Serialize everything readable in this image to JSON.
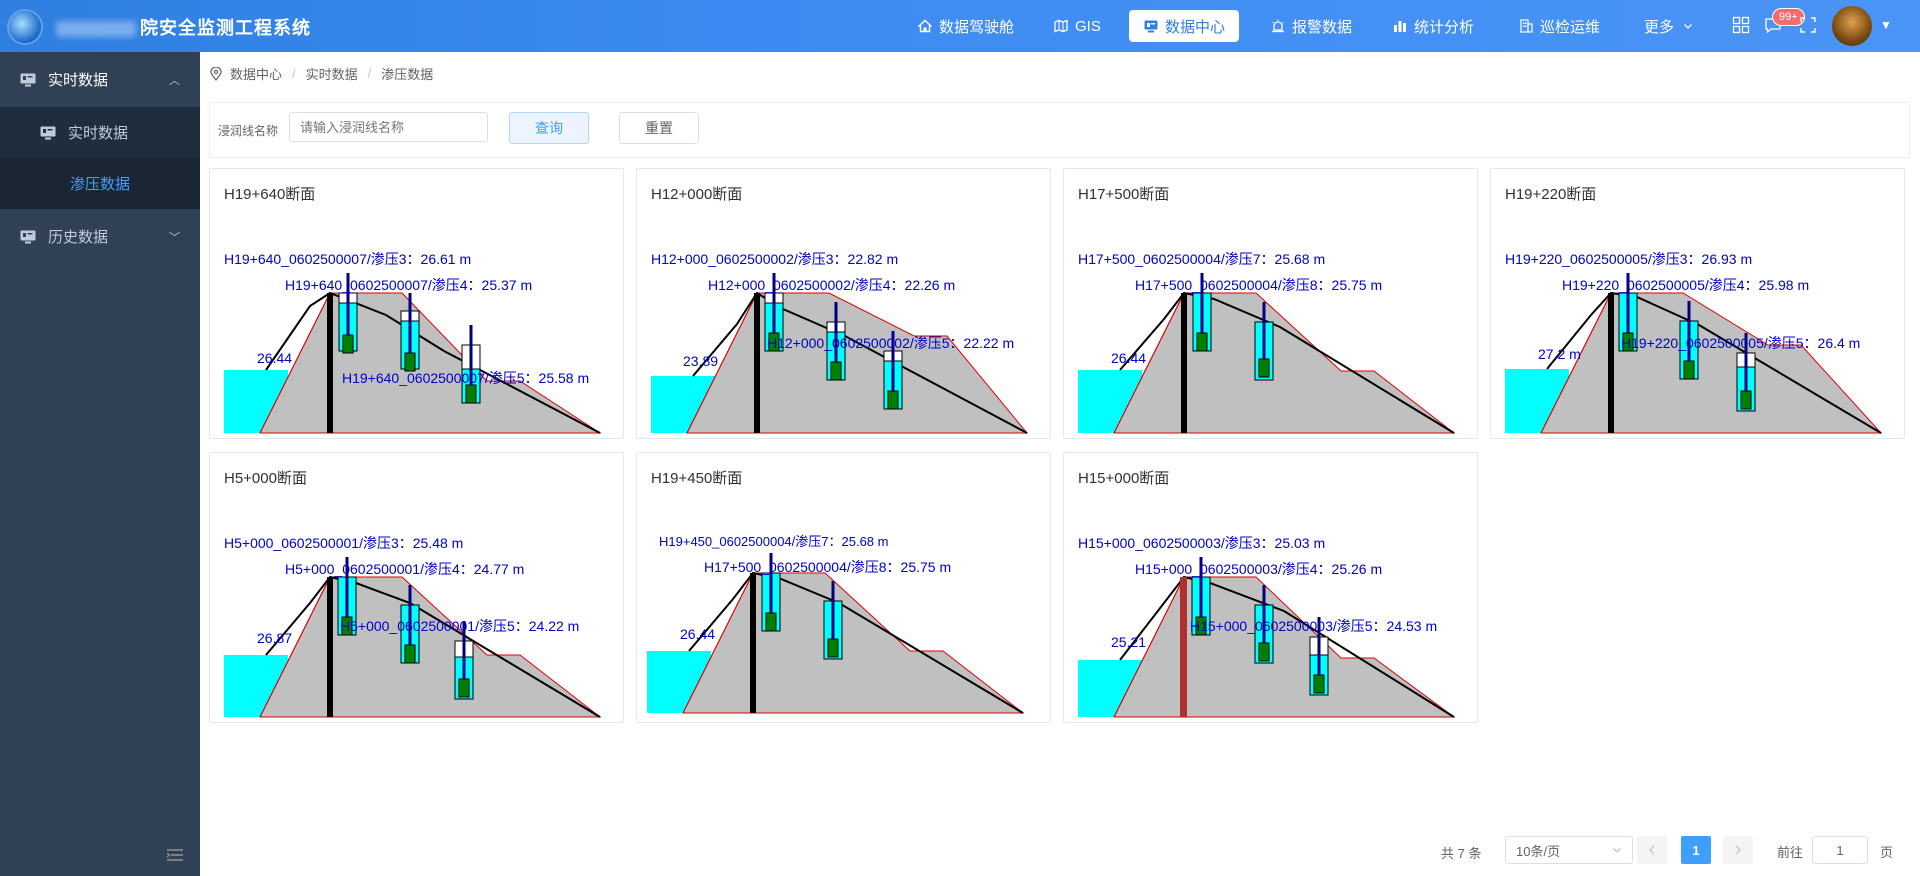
{
  "app": {
    "title": "院安全监测工程系统"
  },
  "nav": [
    {
      "label": "数据驾驶舱",
      "icon": "home-icon"
    },
    {
      "label": "GIS",
      "icon": "map-icon"
    },
    {
      "label": "数据中心",
      "icon": "monitor-icon",
      "active": true
    },
    {
      "label": "报警数据",
      "icon": "alarm-icon"
    },
    {
      "label": "统计分析",
      "icon": "bar-chart-icon"
    },
    {
      "label": "巡检运维",
      "icon": "building-icon"
    },
    {
      "label": "更多",
      "icon": "chevron-down-icon"
    }
  ],
  "notifications": {
    "badge": "99+"
  },
  "sidebar": {
    "items": [
      {
        "label": "实时数据",
        "expanded": true
      },
      {
        "label": "实时数据",
        "sub": true
      },
      {
        "label": "渗压数据",
        "sub": true,
        "active": true
      },
      {
        "label": "历史数据",
        "expanded": false
      }
    ]
  },
  "breadcrumb": [
    "数据中心",
    "实时数据",
    "渗压数据"
  ],
  "filter": {
    "label": "浸润线名称",
    "placeholder": "请输入浸润线名称",
    "query_label": "查询",
    "reset_label": "重置"
  },
  "colors": {
    "accent": "#409eff",
    "water": "#00ffff",
    "dam": "#c0c0c0",
    "label": "#0000cc",
    "sensor": "#008000"
  },
  "cards": [
    {
      "title": "H19+640断面",
      "water_level": "26.44",
      "labels": [
        "H19+640_0602500007/渗压3：26.61 m",
        "H19+640_0602500007/渗压4：25.37 m",
        "H19+640_0602500007/渗压5：25.58 m"
      ]
    },
    {
      "title": "H12+000断面",
      "water_level": "23.89",
      "labels": [
        "H12+000_0602500002/渗压3：22.82 m",
        "H12+000_0602500002/渗压4：22.26 m",
        "H12+000_0602500002/渗压5：22.22 m"
      ]
    },
    {
      "title": "H17+500断面",
      "water_level": "26.44",
      "labels": [
        "H17+500_0602500004/渗压7：25.68 m",
        "H17+500_0602500004/渗压8：25.75 m"
      ]
    },
    {
      "title": "H19+220断面",
      "water_level": "27.2 m",
      "labels": [
        "H19+220_0602500005/渗压3：26.93 m",
        "H19+220_0602500005/渗压4：25.98 m",
        "H19+220_0602500005/渗压5：26.4 m"
      ]
    },
    {
      "title": "H5+000断面",
      "water_level": "26.87",
      "labels": [
        "H5+000_0602500001/渗压3：25.48 m",
        "H5+000_0602500001/渗压4：24.77 m",
        "H5+000_0602500001/渗压5：24.22 m"
      ]
    },
    {
      "title": "H19+450断面",
      "water_level": "26.44",
      "labels": [
        "H19+450_0602500004/渗压7：25.68 m",
        "H17+500_0602500004/渗压8：25.75 m"
      ]
    },
    {
      "title": "H15+000断面",
      "water_level": "25.21",
      "labels": [
        "H15+000_0602500003/渗压3：25.03 m",
        "H15+000_0602500003/渗压4：25.26 m",
        "H15+000_0602500003/渗压5：24.53 m"
      ]
    }
  ],
  "pagination": {
    "total": "共 7 条",
    "page_size": "10条/页",
    "current": "1",
    "goto_label": "前往",
    "goto_value": "1",
    "goto_unit": "页"
  }
}
